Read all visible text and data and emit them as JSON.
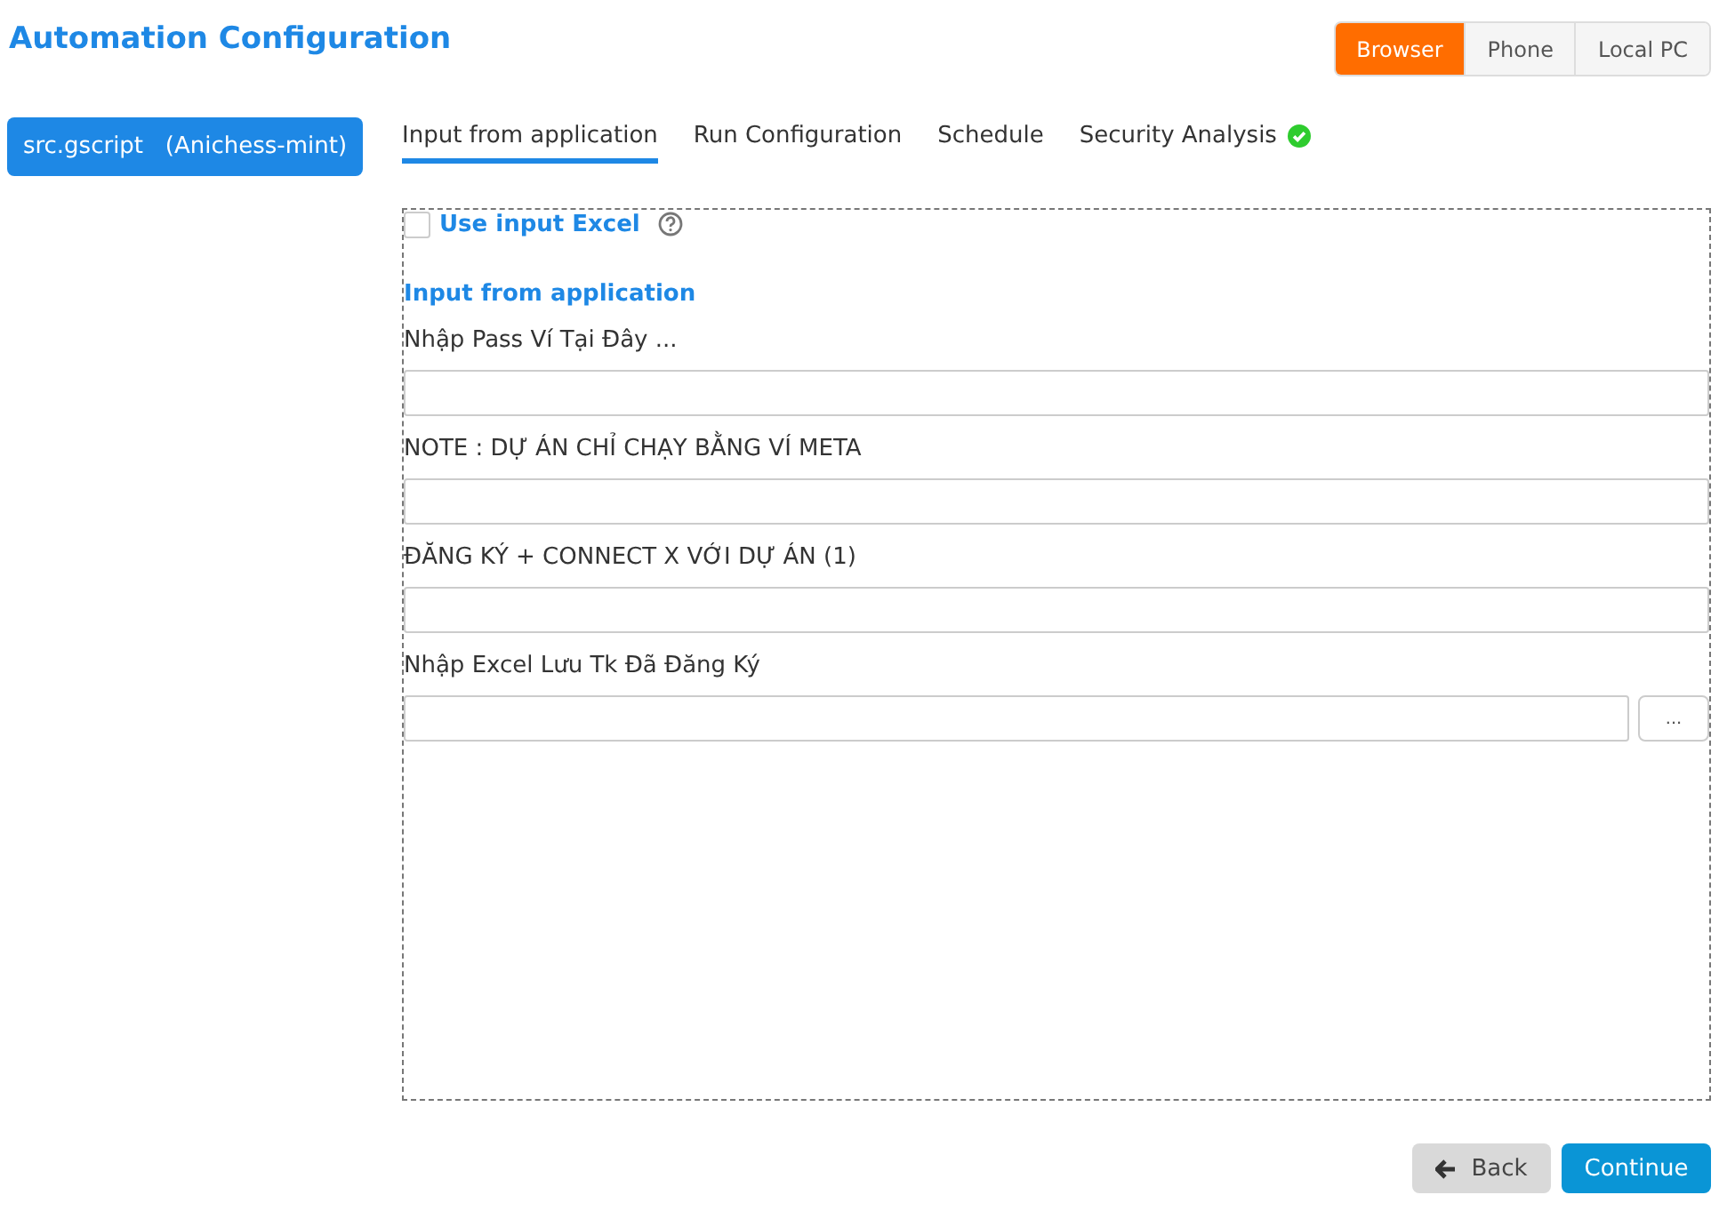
{
  "title": "Automation Configuration",
  "platforms": [
    {
      "label": "Browser",
      "selected": true
    },
    {
      "label": "Phone",
      "selected": false
    },
    {
      "label": "Local PC",
      "selected": false
    }
  ],
  "script_button": "src.gscript   (Anichess-mint)",
  "tabs": [
    {
      "label": "Input from application",
      "selected": true,
      "verified": false
    },
    {
      "label": "Run Configuration",
      "selected": false,
      "verified": false
    },
    {
      "label": "Schedule",
      "selected": false,
      "verified": false
    },
    {
      "label": "Security Analysis",
      "selected": false,
      "verified": true
    }
  ],
  "use_input_excel": {
    "label": "Use input Excel",
    "checked": false
  },
  "section_title": "Input from application",
  "fields": [
    {
      "label": "Nhập Pass Ví Tại Đây ...",
      "kind": "text"
    },
    {
      "label": "NOTE : DỰ ÁN CHỈ CHẠY BẰNG VÍ META",
      "kind": "text"
    },
    {
      "label": "ĐĂNG KÝ + CONNECT X VỚI DỰ ÁN (1)",
      "kind": "text"
    },
    {
      "label": "Nhập Excel Lưu Tk Đã Đăng Ký",
      "kind": "file",
      "browse": "..."
    }
  ],
  "back_button": "Back",
  "continue_button": "Continue"
}
